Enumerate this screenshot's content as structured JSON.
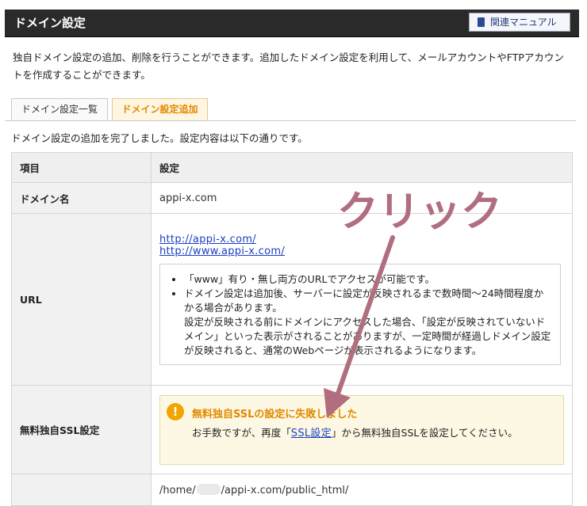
{
  "header": {
    "title": "ドメイン設定",
    "manual_button": "関連マニュアル"
  },
  "description": "独自ドメイン設定の追加、削除を行うことができます。追加したドメイン設定を利用して、メールアカウントやFTPアカウントを作成することができます。",
  "tabs": [
    {
      "label": "ドメイン設定一覧",
      "active": false
    },
    {
      "label": "ドメイン設定追加",
      "active": true
    }
  ],
  "completion_message": "ドメイン設定の追加を完了しました。設定内容は以下の通りです。",
  "table": {
    "col_item": "項目",
    "col_setting": "設定",
    "domain_label": "ドメイン名",
    "domain_value": "appi-x.com",
    "url_label": "URL",
    "url_links": [
      "http://appi-x.com/",
      "http://www.appi-x.com/"
    ],
    "url_notes": [
      "「www」有り・無し両方のURLでアクセスが可能です。",
      "ドメイン設定は追加後、サーバーに設定が反映されるまで数時間～24時間程度かかる場合があります。",
      "設定が反映される前にドメインにアクセスした場合、「設定が反映されていないドメイン」といった表示がされることがありますが、一定時間が経過しドメイン設定が反映されると、通常のWebページが表示されるようになります。"
    ],
    "ssl_label": "無料独自SSL設定",
    "ssl_warning_title": "無料独自SSLの設定に失敗しました",
    "ssl_warning_pre": "お手数ですが、再度「",
    "ssl_warning_link": "SSL設定",
    "ssl_warning_post": "」から無料独自SSLを設定してください。",
    "path_prefix": "/home/",
    "path_suffix": "/appi-x.com/public_html/"
  },
  "annotation": {
    "text": "クリック",
    "color": "#b06e7e"
  },
  "colors": {
    "header_bg": "#2a2a2a",
    "active_tab": "#e08a00",
    "link": "#1a3fc2",
    "warning_bg": "#fdf8e4"
  },
  "icons": {
    "manual": "book-icon",
    "warning": "exclamation-icon"
  }
}
